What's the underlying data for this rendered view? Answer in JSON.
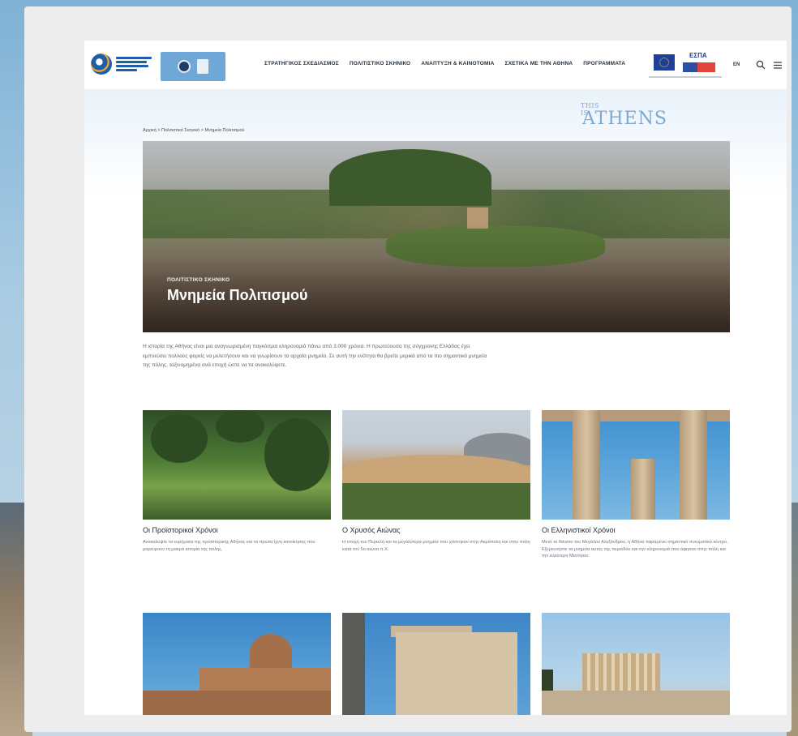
{
  "header": {
    "nav": [
      "ΣΤΡΑΤΗΓΙΚΟΣ ΣΧΕΔΙΑΣΜΟΣ",
      "ΠΟΛΙΤΙΣΤΙΚΟ ΣΚΗΝΙΚΟ",
      "ΑΝΑΠΤΥΞΗ & ΚΑΙΝΟΤΟΜΙΑ",
      "ΣΧΕΤΙΚΑ ΜΕ ΤΗΝ ΑΘΗΝΑ",
      "ΠΡΟΓΡΑΜΜΑΤΑ"
    ],
    "espa_label": "ΕΣΠΑ",
    "lang": "EN"
  },
  "brand": {
    "small": "THIS IS",
    "big": "ATHENS"
  },
  "breadcrumb": "Αρχική  >  Πολιτιστικό Σκηνικό  >  Μνημεία Πολιτισμού",
  "hero": {
    "kicker": "ΠΟΛΙΤΙΣΤΙΚΟ ΣΚΗΝΙΚΟ",
    "title": "Μνημεία Πολιτισμού"
  },
  "intro": "Η ιστορία της Αθήνας είναι μια αναγνωρισμένη παγκόσμια κληρονομιά πάνω από 3.000 χρόνια. Η πρωτεύουσα της σύγχρονης Ελλάδας έχει εμπνεύσει πολλούς φορείς να μελετήσουν και να γνωρίσουν τα αρχαία μνημεία. Σε αυτή την ενότητα θα βρείτε μερικά από τα πιο σημαντικά μνημεία της πόλης, ταξινομημένα ανά εποχή ώστε να τα ανακαλύψετε.",
  "cards": [
    {
      "title": "Οι Προϊστορικοί Χρόνοι",
      "text": "Ανακαλύψτε τα ευρήματα της προϊστορικής Αθήνας και τα πρώτα ίχνη κατοίκησης που μαρτυρούν τη μακρά ιστορία της πόλης."
    },
    {
      "title": "Ο Χρυσός Αιώνας",
      "text": "Η εποχή του Περικλή και τα μεγαλύτερα μνημεία που χτίστηκαν στην Ακρόπολη και στην πόλη κατά τον 5ο αιώνα π.Χ."
    },
    {
      "title": "Οι Ελληνιστικοί Χρόνοι",
      "text": "Μετά το θάνατο του Μεγάλου Αλεξάνδρου, η Αθήνα παραμένει σημαντικό πνευματικό κέντρο. Εξερευνήστε τα μνημεία αυτής της περιόδου και την κληρονομιά που άφησαν στην πόλη και την ευρύτερη Μεσόγειο."
    },
    {
      "title": "",
      "text": ""
    },
    {
      "title": "",
      "text": ""
    },
    {
      "title": "",
      "text": ""
    }
  ]
}
